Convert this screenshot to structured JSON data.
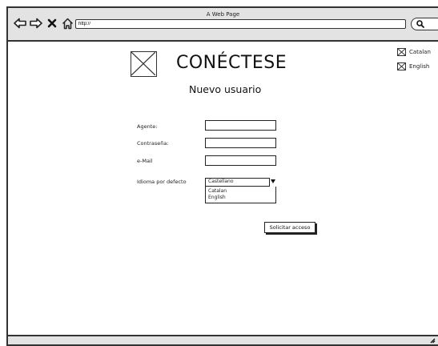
{
  "window": {
    "title": "A Web Page"
  },
  "toolbar": {
    "back_icon": "back-arrow-icon",
    "forward_icon": "forward-arrow-icon",
    "stop_icon": "stop-x-icon",
    "home_icon": "home-icon",
    "address": "http://",
    "search_icon": "search-icon"
  },
  "header": {
    "title": "CONÉCTESE",
    "subtitle": "Nuevo usuario"
  },
  "languages": [
    {
      "label": "Catalan"
    },
    {
      "label": "English"
    }
  ],
  "form": {
    "agent_label": "Agente:",
    "password_label": "Contraseña:",
    "email_label": "e-Mail",
    "language_label": "Idioma por defecto",
    "language_selected": "Castellano",
    "language_options": [
      "Catalan",
      "English"
    ],
    "submit_label": "Solicitar acceso"
  }
}
